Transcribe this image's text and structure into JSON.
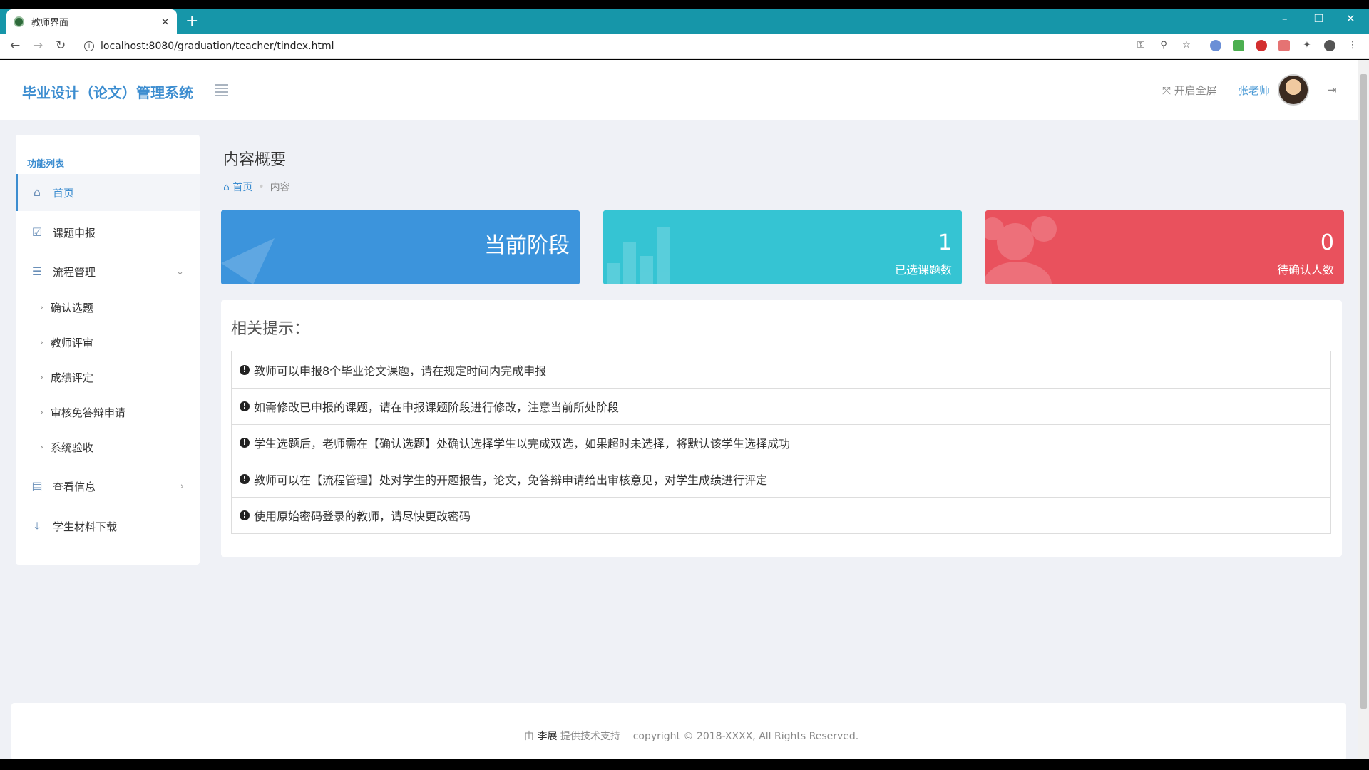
{
  "browser": {
    "tab_title": "教师界面",
    "tab_close": "×",
    "new_tab": "+",
    "url": "localhost:8080/graduation/teacher/tindex.html",
    "win_min": "–",
    "win_max": "❐",
    "win_close": "✕"
  },
  "header": {
    "brand": "毕业设计（论文）管理系统",
    "fullscreen": "开启全屏",
    "username": "张老师"
  },
  "sidebar": {
    "title": "功能列表",
    "items": [
      {
        "label": "首页"
      },
      {
        "label": "课题申报"
      },
      {
        "label": "流程管理"
      },
      {
        "label": "查看信息"
      },
      {
        "label": "学生材料下载"
      }
    ],
    "sub_items": [
      {
        "label": "确认选题"
      },
      {
        "label": "教师评审"
      },
      {
        "label": "成绩评定"
      },
      {
        "label": "审核免答辩申请"
      },
      {
        "label": "系统验收"
      }
    ]
  },
  "content": {
    "title": "内容概要",
    "breadcrumb": {
      "home": "首页",
      "current": "内容"
    }
  },
  "cards": {
    "stage": {
      "text": "当前阶段",
      "color": "#3c94dc"
    },
    "selected": {
      "value": "1",
      "label": "已选课题数",
      "color": "#35c4d3"
    },
    "pending": {
      "value": "0",
      "label": "待确认人数",
      "color": "#e9515d"
    }
  },
  "tips": {
    "title": "相关提示：",
    "items": [
      "教师可以申报8个毕业论文课题，请在规定时间内完成申报",
      "如需修改已申报的课题，请在申报课题阶段进行修改，注意当前所处阶段",
      "学生选题后，老师需在【确认选题】处确认选择学生以完成双选，如果超时未选择，将默认该学生选择成功",
      "教师可以在【流程管理】处对学生的开题报告，论文，免答辩申请给出审核意见，对学生成绩进行评定",
      "使用原始密码登录的教师，请尽快更改密码"
    ]
  },
  "footer": {
    "prefix": "由",
    "author": "李展",
    "suffix": "提供技术支持",
    "copyright": "copyright © 2018-XXXX, All Rights Reserved."
  }
}
